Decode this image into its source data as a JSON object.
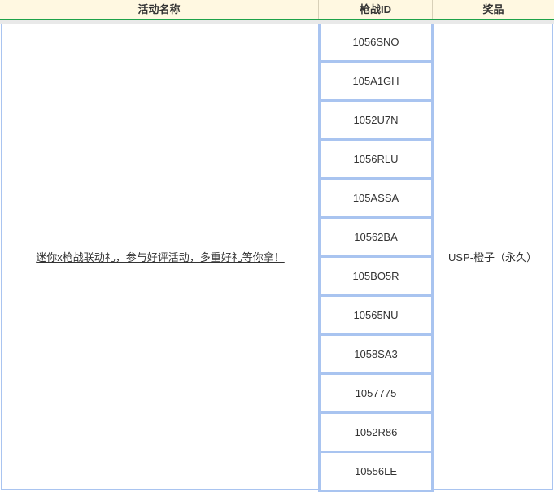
{
  "table": {
    "headers": {
      "name": "活动名称",
      "id": "枪战ID",
      "prize": "奖品"
    },
    "activity_name": "迷你x枪战联动礼，参与好评活动，多重好礼等你拿！",
    "ids": [
      "1056SNO",
      "105A1GH",
      "1052U7N",
      "1056RLU",
      "105ASSA",
      "10562BA",
      "105BO5R",
      "10565NU",
      "1058SA3",
      "1057775",
      "1052R86",
      "10556LE"
    ],
    "prize": "USP-橙子（永久）"
  }
}
